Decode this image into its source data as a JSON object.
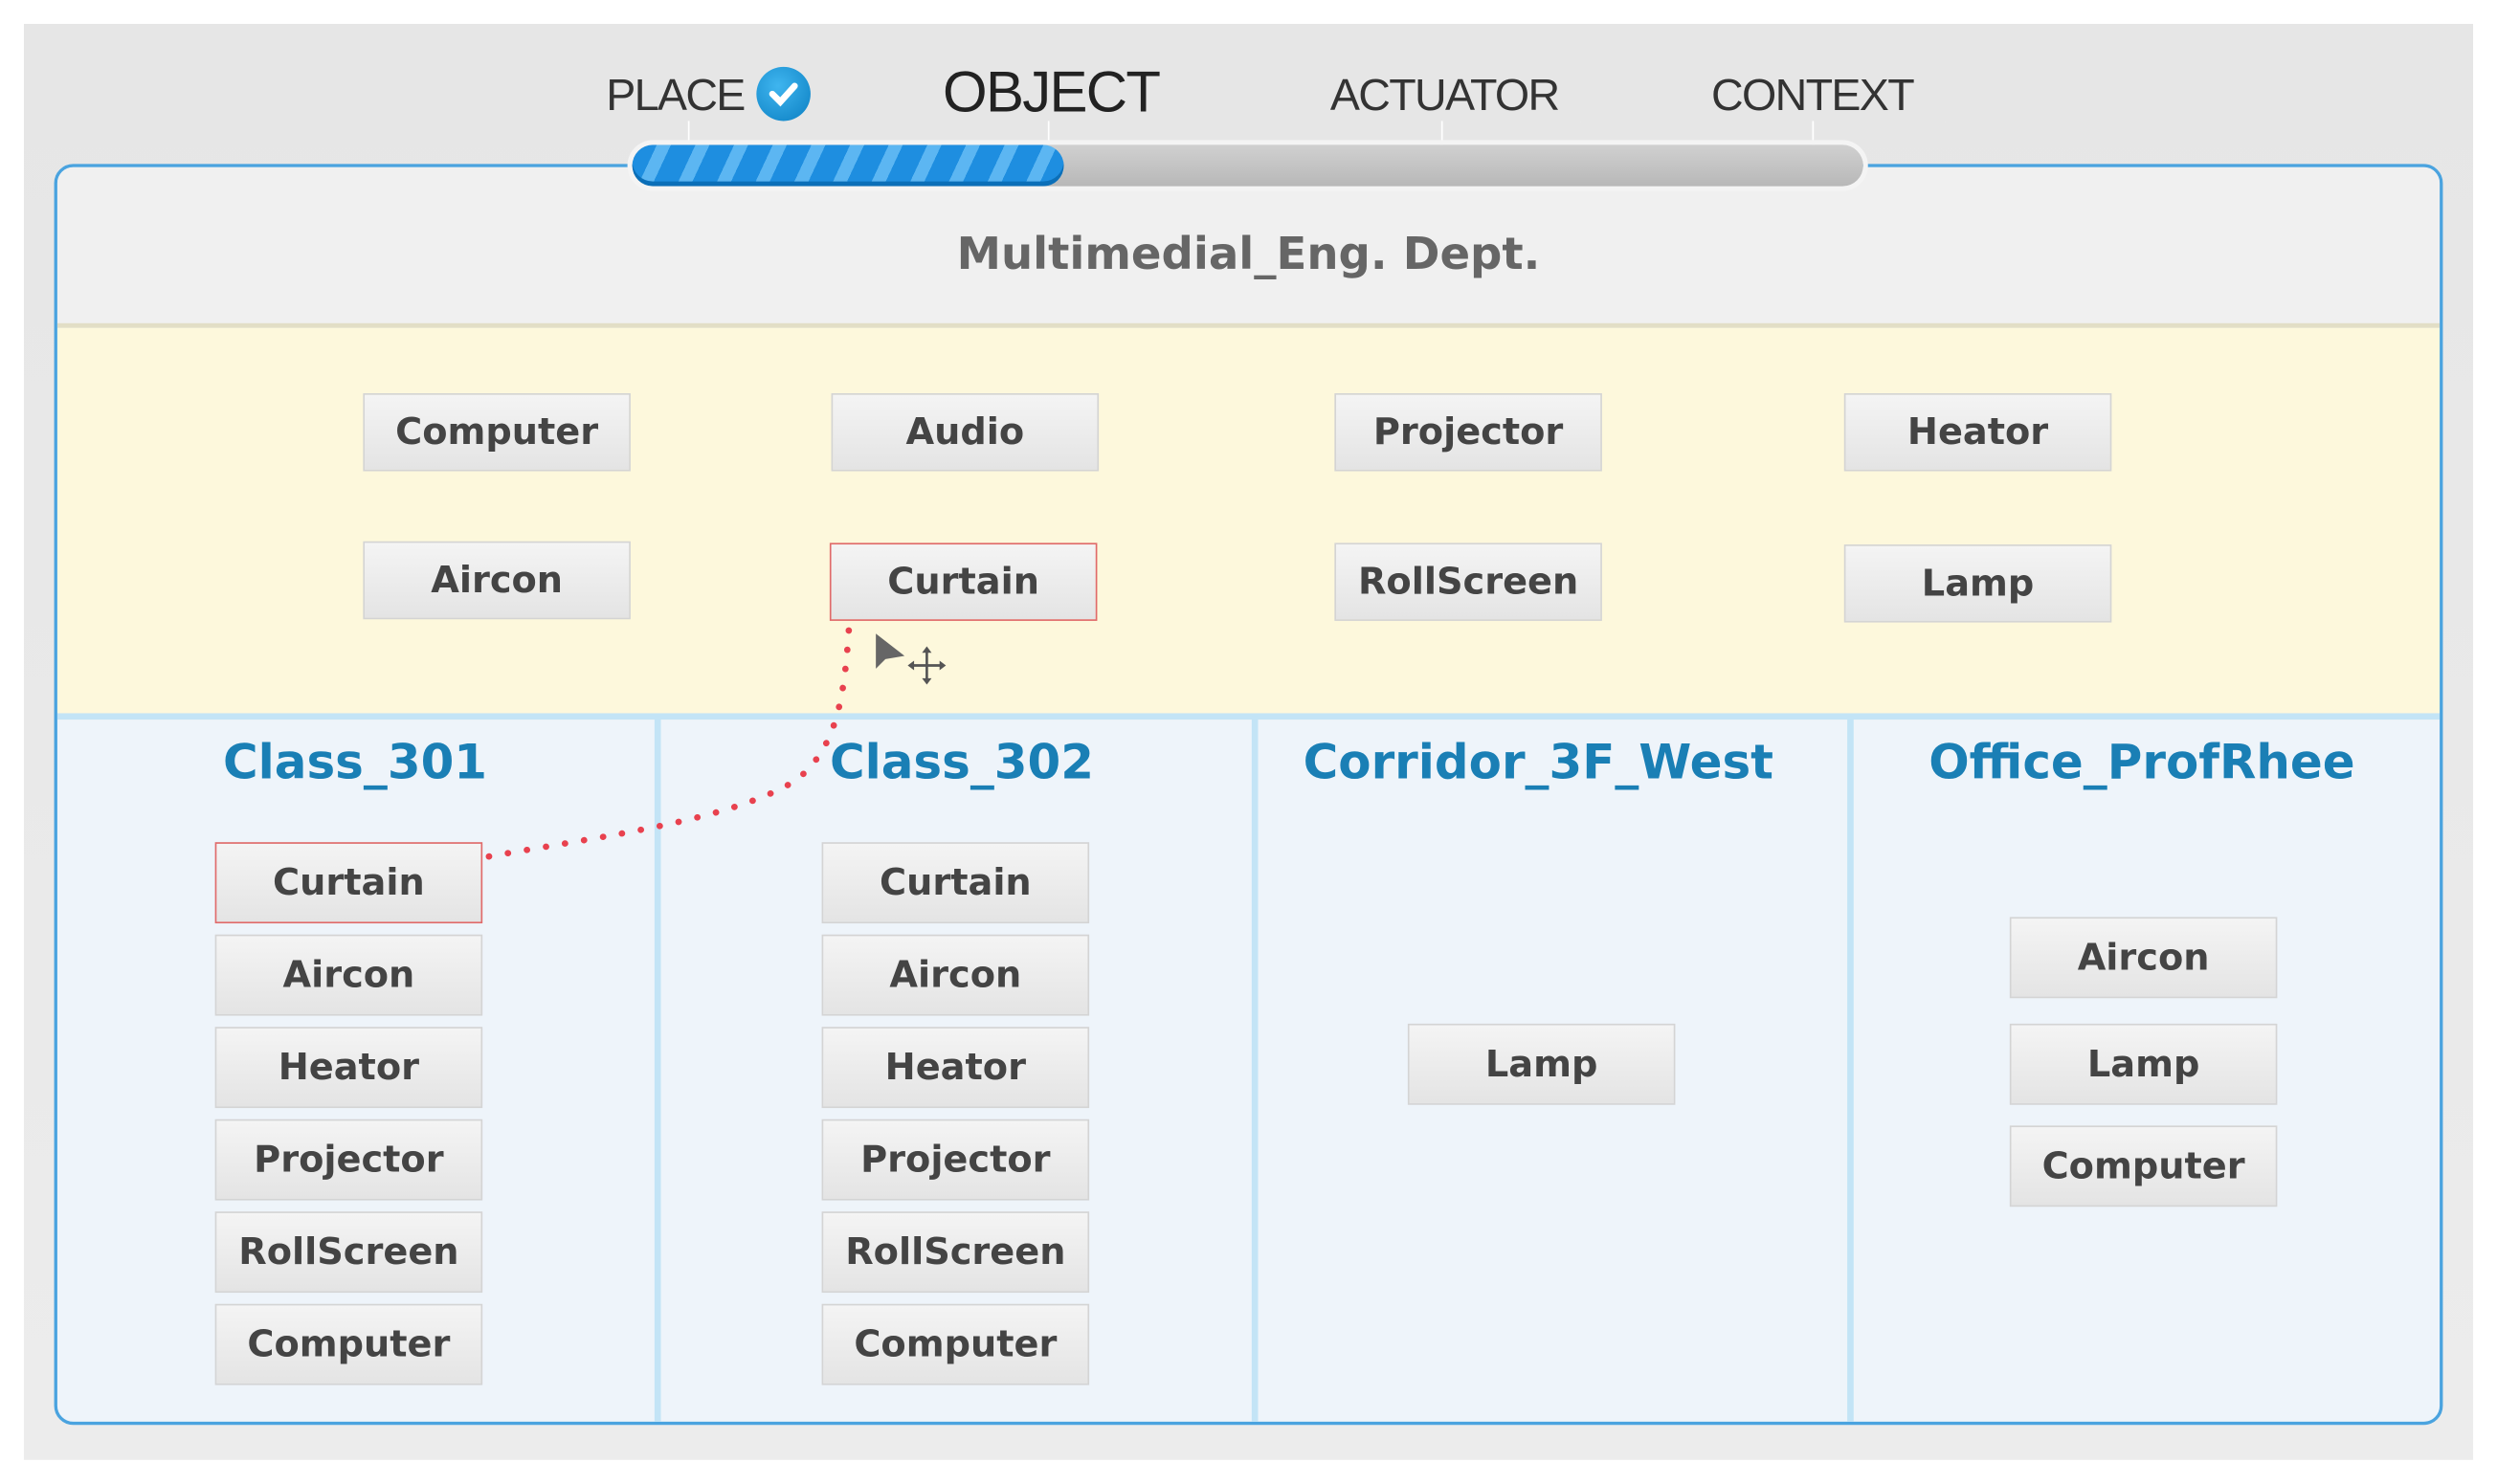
{
  "steps": [
    {
      "label": "PLACE",
      "done": true
    },
    {
      "label": "OBJECT",
      "active": true
    },
    {
      "label": "ACTUATOR"
    },
    {
      "label": "CONTEXT"
    }
  ],
  "progress_percent": 35,
  "department": "Multimedial_Eng. Dept.",
  "object_pool": [
    "Computer",
    "Audio",
    "Projector",
    "Heator",
    "Aircon",
    "Curtain",
    "RollScreen",
    "Lamp"
  ],
  "selected_object": "Curtain",
  "places": [
    {
      "name": "Class_301",
      "objects": [
        "Curtain",
        "Aircon",
        "Heator",
        "Projector",
        "RollScreen",
        "Computer"
      ]
    },
    {
      "name": "Class_302",
      "objects": [
        "Curtain",
        "Aircon",
        "Heator",
        "Projector",
        "RollScreen",
        "Computer"
      ]
    },
    {
      "name": "Corridor_3F_West",
      "objects": [
        "Lamp"
      ]
    },
    {
      "name": "Office_ProfRhee",
      "objects": [
        "Aircon",
        "Lamp",
        "Computer"
      ]
    }
  ],
  "colors": {
    "accent": "#4aa3df",
    "title": "#1a7fb5",
    "drag_line": "#e8414e",
    "pool_bg": "#fdf8dc"
  }
}
